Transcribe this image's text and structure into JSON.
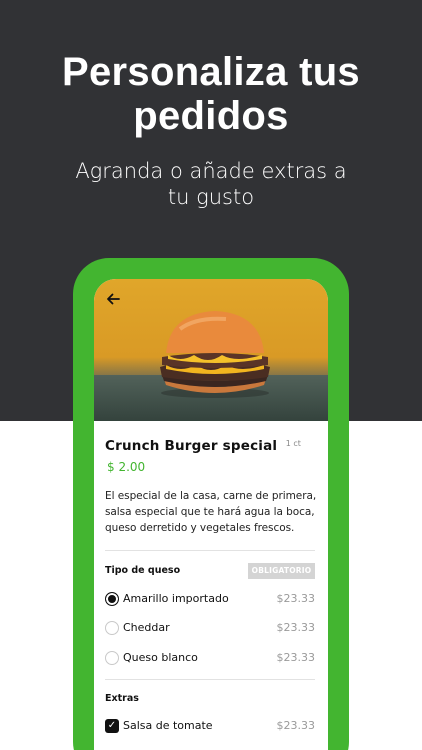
{
  "headline": "Personaliza tus pedidos",
  "subhead": "Agranda o añade extras a tu gusto",
  "colors": {
    "background_dark": "#313235",
    "accent_green": "#43b530",
    "badge_gray": "#d4d4d4"
  },
  "screen": {
    "back_icon": "arrow-left-icon",
    "product": {
      "title": "Crunch Burger special",
      "unit": "1 ct",
      "price": "$ 2.00",
      "description": "El especial de la casa, carne de primera, salsa especial que te hará agua la boca, queso derretido y vegetales frescos."
    },
    "cheese_section": {
      "title": "Tipo de queso",
      "badge": "OBLIGATORIO",
      "options": [
        {
          "label": "Amarillo importado",
          "price": "$23.33",
          "selected": true
        },
        {
          "label": "Cheddar",
          "price": "$23.33",
          "selected": false
        },
        {
          "label": "Queso blanco",
          "price": "$23.33",
          "selected": false
        }
      ]
    },
    "extras_section": {
      "title": "Extras",
      "options": [
        {
          "label": "Salsa de tomate",
          "price": "$23.33",
          "checked": true
        }
      ]
    }
  }
}
